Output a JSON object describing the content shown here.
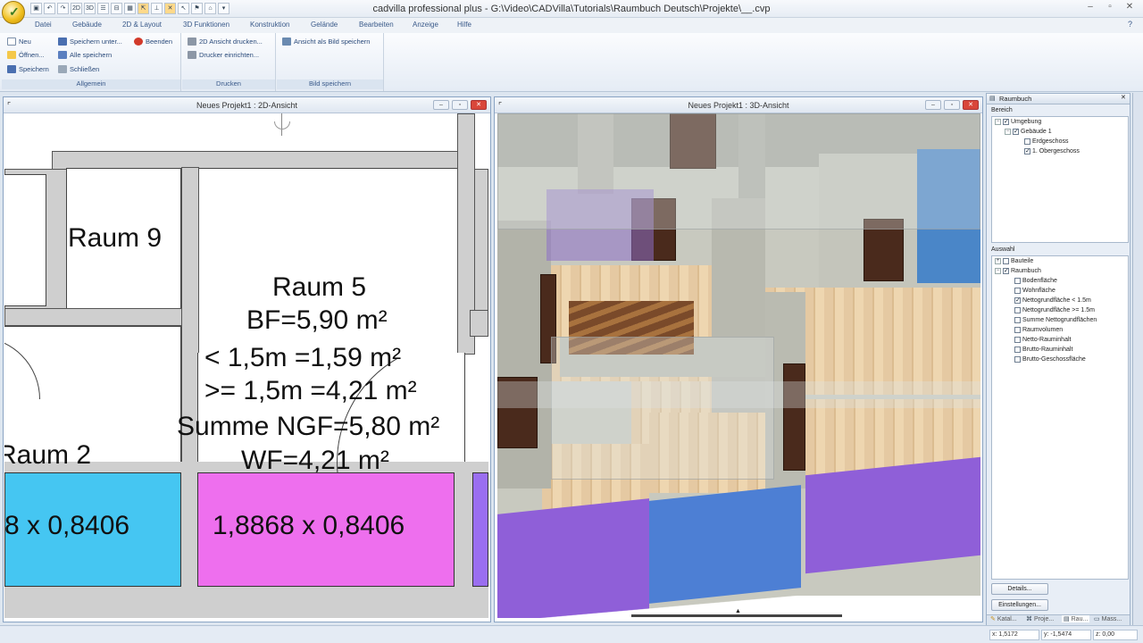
{
  "window": {
    "title": "cadvilla professional plus - G:\\Video\\CADVilla\\Tutorials\\Raumbuch Deutsch\\Projekte\\__.cvp"
  },
  "menu": [
    "Datei",
    "Gebäude",
    "2D & Layout",
    "3D Funktionen",
    "Konstruktion",
    "Gelände",
    "Bearbeiten",
    "Anzeige",
    "Hilfe"
  ],
  "ribbon": {
    "allgemein": {
      "label": "Allgemein",
      "neu": "Neu",
      "oeffnen": "Öffnen...",
      "speichern": "Speichern",
      "speichern_unter": "Speichern unter...",
      "alle_speichern": "Alle speichern",
      "schliessen": "Schließen",
      "beenden": "Beenden"
    },
    "drucken": {
      "label": "Drucken",
      "ansicht_drucken": "2D Ansicht drucken...",
      "drucker": "Drucker einrichten..."
    },
    "bild": {
      "label": "Bild speichern",
      "ansicht_bild": "Ansicht als Bild speichern"
    }
  },
  "view2d": {
    "title": "Neues Projekt1 : 2D-Ansicht",
    "raum9": "Raum 9",
    "raum5": "Raum 5",
    "bf": "BF=5,90 m²",
    "lt": "<   1,5m =1,59 m²",
    "ge": ">= 1,5m =4,21 m²",
    "summe": "Summe NGF=5,80 m²",
    "wf": "WF=4,21 m²",
    "raum2": "Raum 2",
    "win_left": "8 x 0,8406",
    "win_mid": "1,8868 x 0,8406"
  },
  "view3d": {
    "title": "Neues Projekt1 : 3D-Ansicht"
  },
  "sidebar": {
    "title": "Raumbuch",
    "bereich": "Bereich",
    "bereich_tree": [
      {
        "label": "Umgebung",
        "checked": true
      },
      {
        "label": "Gebäude 1",
        "checked": true
      },
      {
        "label": "Erdgeschoss",
        "checked": false
      },
      {
        "label": "1. Obergeschoss",
        "checked": true
      }
    ],
    "auswahl": "Auswahl",
    "auswahl_tree": [
      {
        "label": "Bauteile",
        "checked": false
      },
      {
        "label": "Raumbuch",
        "checked": true
      },
      {
        "label": "Bodenfläche",
        "checked": false
      },
      {
        "label": "Wohnfläche",
        "checked": false
      },
      {
        "label": "Nettogrundfläche < 1.5m",
        "checked": true
      },
      {
        "label": "Nettogrundfläche >= 1.5m",
        "checked": false
      },
      {
        "label": "Summe Nettogrundflächen",
        "checked": false
      },
      {
        "label": "Raumvolumen",
        "checked": false
      },
      {
        "label": "Netto-Rauminhalt",
        "checked": false
      },
      {
        "label": "Brutto-Rauminhalt",
        "checked": false
      },
      {
        "label": "Brutto-Geschossfläche",
        "checked": false
      }
    ],
    "details": "Details...",
    "einstellungen": "Einstellungen...",
    "tabs": [
      "Katal...",
      "Proje...",
      "Rau...",
      "Mass..."
    ]
  },
  "status": {
    "x": "x: 1,5172",
    "y": "y: -1,5474",
    "z": "z: 0,00"
  }
}
